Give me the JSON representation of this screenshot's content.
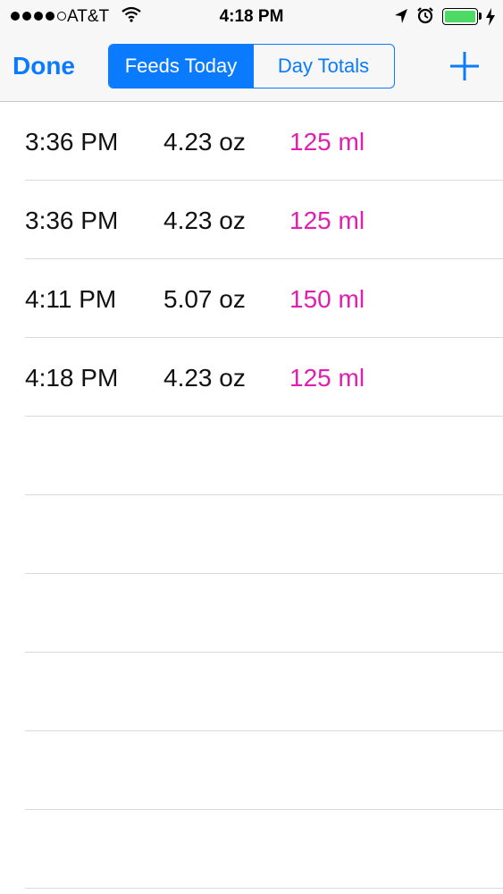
{
  "status_bar": {
    "carrier": "AT&T",
    "time": "4:18 PM",
    "signal_bars_filled": 4,
    "signal_bars_total": 5,
    "battery_level": 1.0,
    "battery_color": "#4cd964",
    "icons": [
      "signal-dots-icon",
      "wifi-icon",
      "location-arrow-icon",
      "alarm-clock-icon",
      "battery-icon",
      "charging-bolt-icon"
    ]
  },
  "nav": {
    "done_label": "Done",
    "tabs": [
      {
        "label": "Feeds Today",
        "selected": true
      },
      {
        "label": "Day Totals",
        "selected": false
      }
    ],
    "add_icon": "plus-icon",
    "accent_color": "#0a7aff"
  },
  "feeds": [
    {
      "time": "3:36 PM",
      "oz": "4.23 oz",
      "ml": "125 ml"
    },
    {
      "time": "3:36 PM",
      "oz": "4.23 oz",
      "ml": "125 ml"
    },
    {
      "time": "4:11 PM",
      "oz": "5.07 oz",
      "ml": "150 ml"
    },
    {
      "time": "4:18 PM",
      "oz": "4.23 oz",
      "ml": "125 ml"
    }
  ],
  "empty_rows": 6,
  "ml_color": "#e01fb0"
}
